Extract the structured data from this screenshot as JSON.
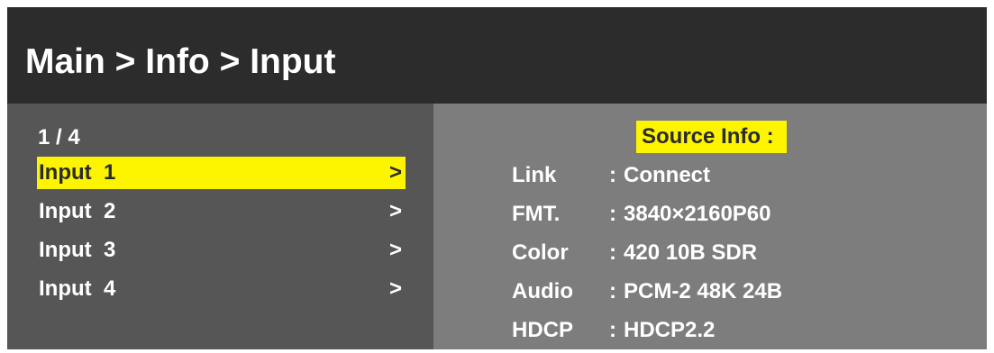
{
  "header": {
    "breadcrumb": "Main > Info > Input"
  },
  "menu": {
    "page_indicator": "1 / 4",
    "items": [
      {
        "label": "Input  1",
        "arrow": ">",
        "selected": true
      },
      {
        "label": "Input  2",
        "arrow": ">",
        "selected": false
      },
      {
        "label": "Input  3",
        "arrow": ">",
        "selected": false
      },
      {
        "label": "Input  4",
        "arrow": ">",
        "selected": false
      }
    ]
  },
  "info": {
    "title": "Source Info :",
    "separator": ":",
    "rows": [
      {
        "key": "Link",
        "value": "Connect"
      },
      {
        "key": "FMT.",
        "value": "3840×2160P60"
      },
      {
        "key": "Color",
        "value": "420 10B SDR"
      },
      {
        "key": "Audio",
        "value": "PCM-2 48K 24B"
      },
      {
        "key": "HDCP",
        "value": "HDCP2.2"
      }
    ]
  },
  "colors": {
    "header_bg": "#2c2c2c",
    "left_panel_bg": "#565656",
    "right_panel_bg": "#7d7d7d",
    "highlight": "#fdf400",
    "text": "#ffffff"
  }
}
